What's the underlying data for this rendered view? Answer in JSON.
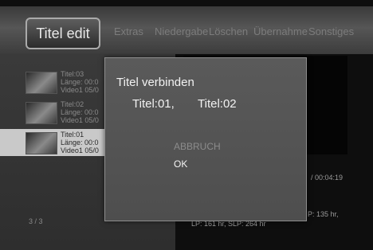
{
  "menu": {
    "tabs": [
      {
        "label": "Titel edit",
        "active": true
      },
      {
        "label": "Extras",
        "active": false
      },
      {
        "label": "Niedergabe",
        "active": false
      },
      {
        "label": "Löschen",
        "active": false
      },
      {
        "label": "Übernahme",
        "active": false
      },
      {
        "label": "Sonstiges",
        "active": false
      }
    ]
  },
  "list": {
    "items": [
      {
        "title": "Titel:03",
        "length": "Länge: 00:0",
        "source": "Video1 05/0",
        "selected": false
      },
      {
        "title": "Titel:02",
        "length": "Länge: 00:0",
        "source": "Video1 05/0",
        "selected": false
      },
      {
        "title": "Titel:01",
        "length": "Länge: 00:0",
        "source": "Video1 05/0",
        "selected": true
      }
    ],
    "counter": "3 / 3"
  },
  "info": {
    "time": "/ 00:04:19",
    "size": "P: 135 hr,",
    "quality": "LP: 161 hr,   SLP: 264 hr"
  },
  "dialog": {
    "title": "Titel verbinden",
    "titles": [
      "Titel:01,",
      "Titel:02"
    ],
    "cancel_label": "ABBRUCH",
    "ok_label": "OK"
  },
  "colors": {
    "background": "#0e0e0e",
    "dialog": "#555555",
    "selected_row": "#c9c9c9",
    "text_active": "#f2f2f2",
    "text_inactive": "#8c8c8c"
  }
}
